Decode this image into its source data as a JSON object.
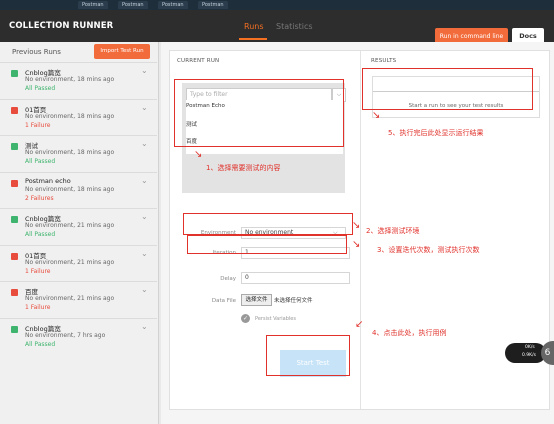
{
  "browser_tabs": [
    "Postman",
    "Postman",
    "Postman",
    "Postman"
  ],
  "header": {
    "title": "COLLECTION RUNNER",
    "tabs": [
      "Runs",
      "Statistics"
    ],
    "run_cmd_label": "Run in command line",
    "docs_label": "Docs"
  },
  "sidebar": {
    "title": "Previous Runs",
    "import_label": "Import Test Run",
    "runs": [
      {
        "name": "Cnblog篇宽",
        "meta": "No environment, 18 mins ago",
        "status": "All Passed",
        "color": "#3fb46e"
      },
      {
        "name": "01首页",
        "meta": "No environment, 18 mins ago",
        "status": "1 Failure",
        "color": "#e84c3d"
      },
      {
        "name": "测试",
        "meta": "No environment, 18 mins ago",
        "status": "All Passed",
        "color": "#3fb46e"
      },
      {
        "name": "Postman echo",
        "meta": "No environment, 18 mins ago",
        "status": "2 Failures",
        "color": "#e84c3d"
      },
      {
        "name": "Cnblog篇宽",
        "meta": "No environment, 21 mins ago",
        "status": "All Passed",
        "color": "#3fb46e"
      },
      {
        "name": "01首页",
        "meta": "No environment, 21 mins ago",
        "status": "1 Failure",
        "color": "#e84c3d"
      },
      {
        "name": "百度",
        "meta": "No environment, 21 mins ago",
        "status": "1 Failure",
        "color": "#e84c3d"
      },
      {
        "name": "Cnblog篇宽",
        "meta": "No environment, 7 hrs ago",
        "status": "All Passed",
        "color": "#3fb46e"
      }
    ]
  },
  "current_run": {
    "section_label": "CURRENT RUN",
    "filter_placeholder": "Type to filter",
    "collections": [
      "Postman Echo",
      "测试",
      "百度"
    ],
    "environment_label": "Environment",
    "environment_value": "No environment",
    "iteration_label": "Iteration",
    "iteration_value": "1",
    "delay_label": "Delay",
    "delay_value": "0",
    "datafile_label": "Data File",
    "choose_file_label": "选择文件",
    "no_file_text": "未选择任何文件",
    "persist_label": "Persist Variables",
    "start_label": "Start Test"
  },
  "results": {
    "section_label": "RESULTS",
    "empty_text": "Start a run to see your test results"
  },
  "annotations": [
    "1、选择需要测试的内容",
    "2、选择测试环境",
    "3、设置迭代次数，测试执行次数",
    "4、点击此处，执行用例",
    "5、执行完后此处显示运行结果"
  ],
  "speed_widget": {
    "up": "0K/s",
    "down": "0.9K/s",
    "badge": "6"
  }
}
